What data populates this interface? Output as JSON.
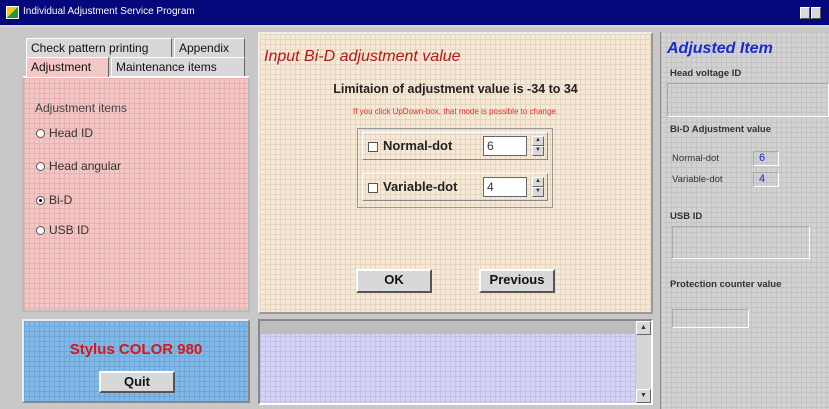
{
  "window": {
    "title": "Individual Adjustment Service Program"
  },
  "tabs": {
    "check_pattern": "Check pattern printing",
    "appendix": "Appendix",
    "adjustment": "Adjustment",
    "maintenance": "Maintenance items"
  },
  "left": {
    "items_label": "Adjustment items",
    "options": [
      {
        "label": "Head ID",
        "selected": false
      },
      {
        "label": "Head angular",
        "selected": false
      },
      {
        "label": "Bi-D",
        "selected": true
      },
      {
        "label": "USB ID",
        "selected": false
      }
    ]
  },
  "stylus": {
    "model": "Stylus COLOR 980",
    "quit_label": "Quit"
  },
  "center": {
    "title": "Input Bi-D adjustment value",
    "limit": "Limitaion of adjustment value is -34 to 34",
    "hint": "If you click UpDown-box, that mode is possible to change.",
    "normal_label": "Normal-dot",
    "normal_value": "6",
    "variable_label": "Variable-dot",
    "variable_value": "4",
    "ok_label": "OK",
    "previous_label": "Previous"
  },
  "right": {
    "title": "Adjusted Item",
    "head_voltage_label": "Head voltage ID",
    "bid_label": "Bi-D Adjustment value",
    "normal_label": "Normal-dot",
    "normal_value": "6",
    "variable_label": "Variable-dot",
    "variable_value": "4",
    "usb_label": "USB ID",
    "protection_label": "Protection counter value"
  },
  "colors": {
    "title_bar": "#05087a",
    "accent_red": "#d81818",
    "accent_blue": "#1a2ad0"
  }
}
